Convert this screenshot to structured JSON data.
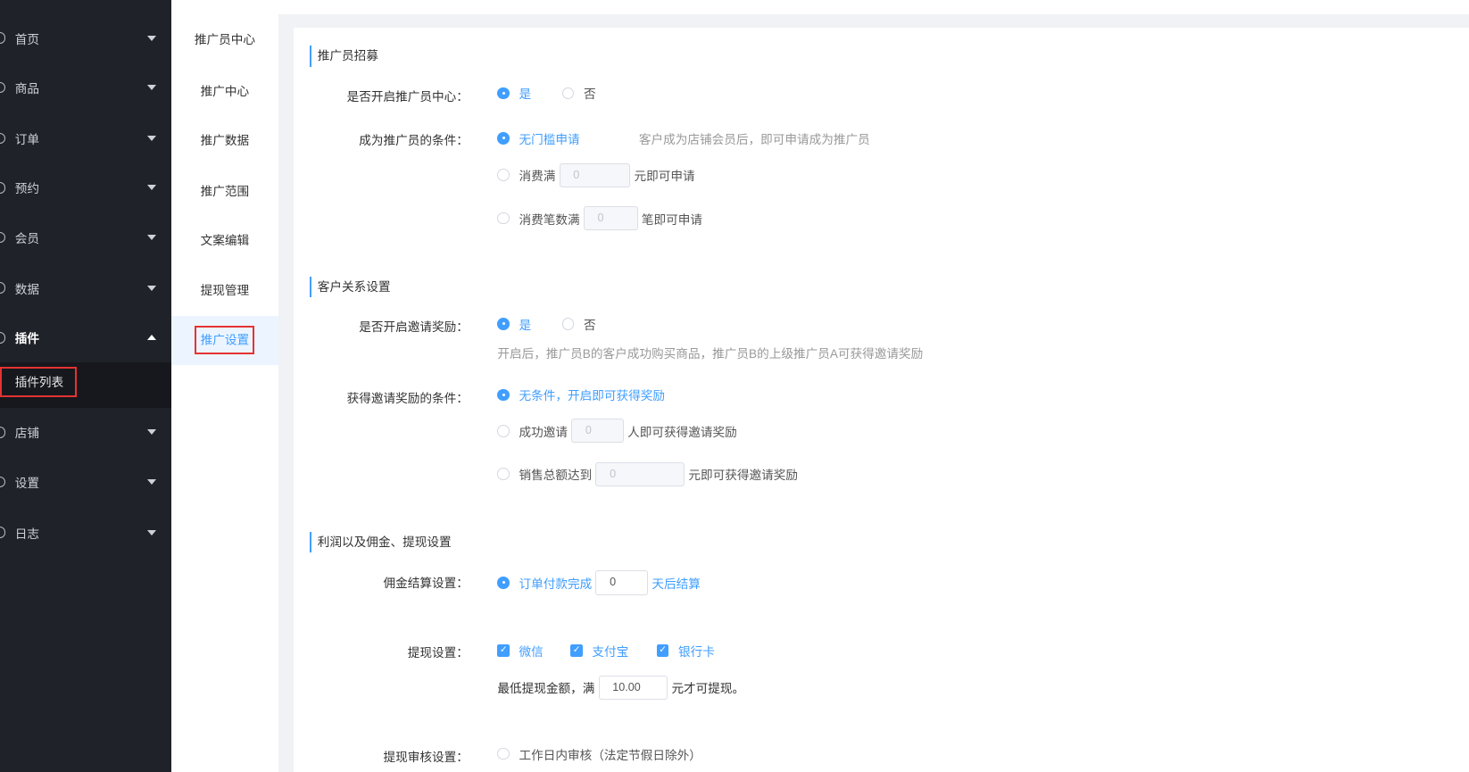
{
  "sidebar": {
    "items": [
      {
        "label": "首页",
        "icon": "home-icon"
      },
      {
        "label": "商品",
        "icon": "goods-icon"
      },
      {
        "label": "订单",
        "icon": "order-icon"
      },
      {
        "label": "预约",
        "icon": "booking-icon"
      },
      {
        "label": "会员",
        "icon": "member-icon"
      },
      {
        "label": "数据",
        "icon": "data-icon"
      },
      {
        "label": "插件",
        "icon": "plugin-icon"
      },
      {
        "label": "店铺",
        "icon": "shop-icon"
      },
      {
        "label": "设置",
        "icon": "settings-icon"
      },
      {
        "label": "日志",
        "icon": "log-icon"
      }
    ],
    "submenu": {
      "label": "插件列表"
    }
  },
  "panel": {
    "items": [
      "推广员中心",
      "推广中心",
      "推广数据",
      "推广范围",
      "文案编辑",
      "提现管理",
      "推广设置"
    ]
  },
  "form": {
    "sec1": "推广员招募",
    "open_center_label": "是否开启推广员中心：",
    "yes": "是",
    "no": "否",
    "cond_label": "成为推广员的条件：",
    "cond_free": "无门槛申请",
    "cond_free_hint": "客户成为店铺会员后，即可申请成为推广员",
    "cond_spend": "消费满",
    "cond_spend_value": "0",
    "cond_spend_suffix": "元即可申请",
    "cond_count": "消费笔数满",
    "cond_count_value": "0",
    "cond_count_suffix": "笔即可申请",
    "sec2": "客户关系设置",
    "invite_label": "是否开启邀请奖励：",
    "invite_hint": "开启后，推广员B的客户成功购买商品，推广员B的上级推广员A可获得邀请奖励",
    "reward_label": "获得邀请奖励的条件：",
    "reward_free": "无条件，开启即可获得奖励",
    "reward_invite": "成功邀请",
    "reward_invite_value": "0",
    "reward_invite_suffix": "人即可获得邀请奖励",
    "reward_sales": "销售总额达到",
    "reward_sales_value": "0",
    "reward_sales_suffix": "元即可获得邀请奖励",
    "sec3": "利润以及佣金、提现设置",
    "settle_label": "佣金结算设置：",
    "settle_prefix": "订单付款完成",
    "settle_value": "0",
    "settle_suffix": "天后结算",
    "withdraw_label": "提现设置：",
    "wechat": "微信",
    "alipay": "支付宝",
    "bank": "银行卡",
    "min_prefix": "最低提现金额，满",
    "min_value": "10.00",
    "min_suffix": "元才可提现。",
    "audit_label": "提现审核设置：",
    "audit_option": "工作日内审核（法定节假日除外）"
  }
}
